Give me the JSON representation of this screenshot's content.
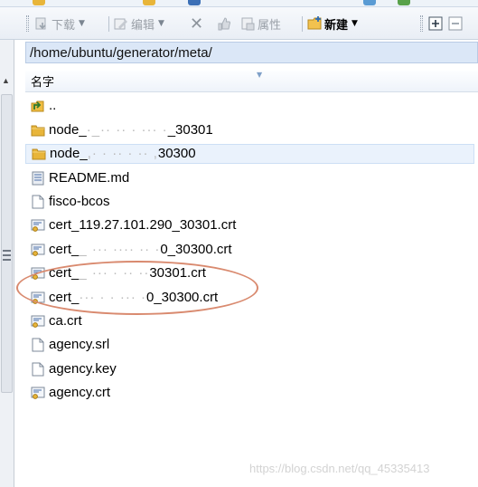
{
  "toolbar": {
    "download_label": "下载",
    "edit_label": "编辑",
    "properties_label": "属性",
    "new_label": "新建"
  },
  "path": "/home/ubuntu/generator/meta/",
  "columns": {
    "name": "名字"
  },
  "files": [
    {
      "name": "..",
      "type": "up-folder"
    },
    {
      "name": "node_",
      "suffix": "_30301",
      "type": "folder"
    },
    {
      "name": "node_",
      "suffix": "30300",
      "type": "folder",
      "selected": true
    },
    {
      "name": "README.md",
      "type": "markdown"
    },
    {
      "name": "fisco-bcos",
      "type": "file"
    },
    {
      "name": "cert_119.27.101.290_30301.crt",
      "type": "certificate"
    },
    {
      "name": "cert_",
      "suffix": "0_30300.crt",
      "type": "certificate"
    },
    {
      "name": "cert_",
      "suffix": "30301.crt",
      "type": "certificate"
    },
    {
      "name": "cert_",
      "suffix": "0_30300.crt",
      "type": "certificate"
    },
    {
      "name": "ca.crt",
      "type": "certificate"
    },
    {
      "name": "agency.srl",
      "type": "file"
    },
    {
      "name": "agency.key",
      "type": "file"
    },
    {
      "name": "agency.crt",
      "type": "certificate"
    }
  ],
  "watermark": "https://blog.csdn.net/qq_45335413",
  "colors": {
    "accent": "#dbe7f7",
    "annotation": "#d98a6f",
    "folder": "#e8b53a"
  }
}
